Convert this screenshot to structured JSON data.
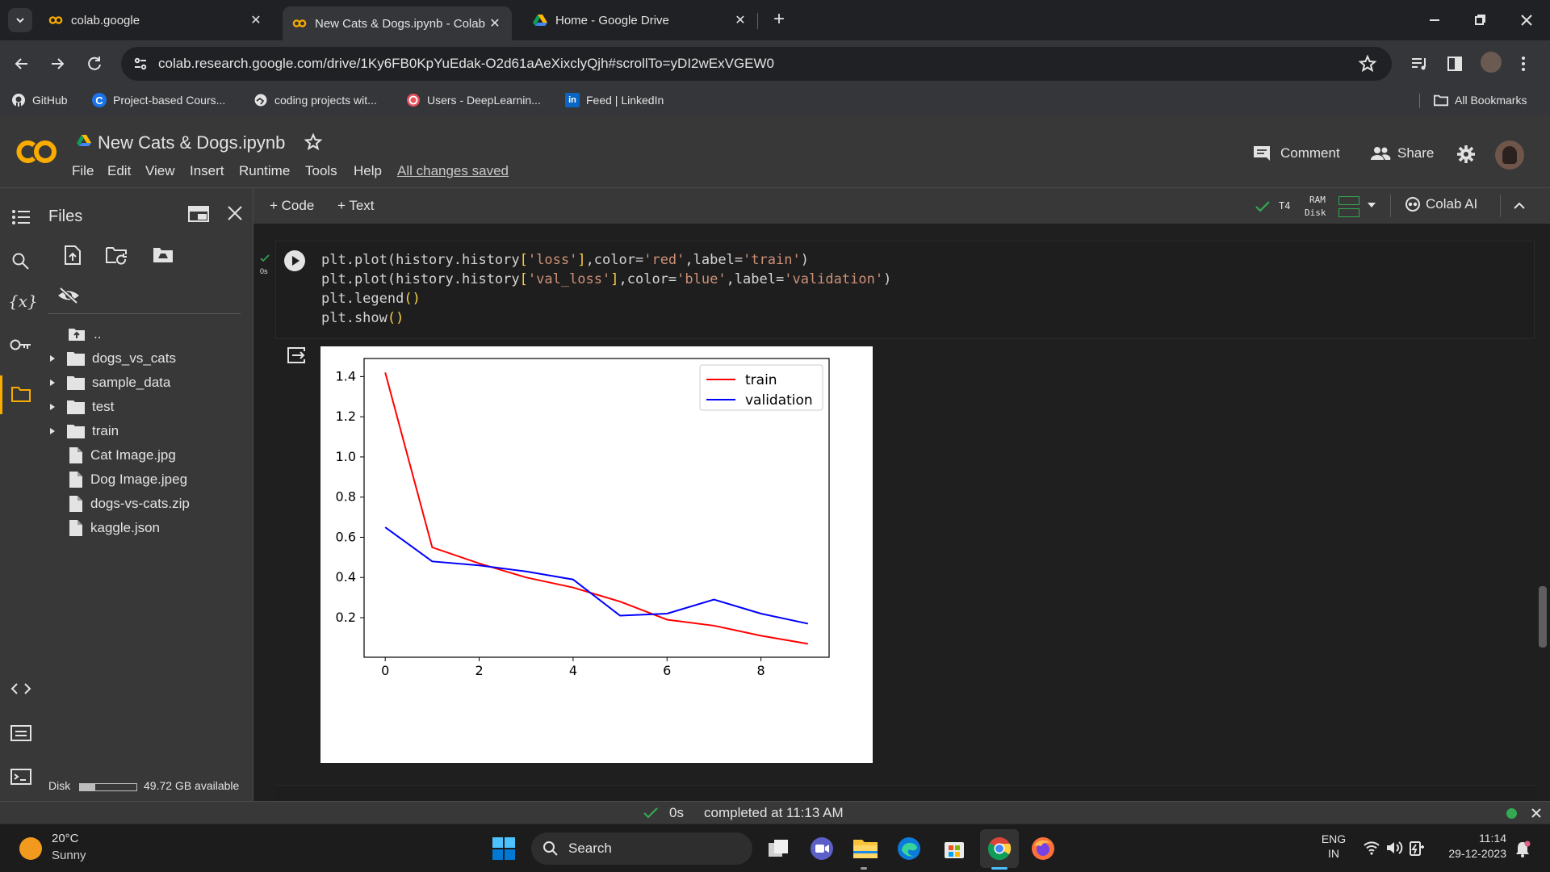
{
  "browser": {
    "tabs": [
      {
        "title": "colab.google",
        "icon": "colab-icon"
      },
      {
        "title": "New Cats & Dogs.ipynb - Colab",
        "icon": "colab-icon",
        "active": true
      },
      {
        "title": "Home - Google Drive",
        "icon": "google-drive-icon"
      }
    ],
    "url": "colab.research.google.com/drive/1Ky6FB0KpYuEdak-O2d61aAeXixclyQjh#scrollTo=yDI2wExVGEW0",
    "bookmarks": [
      "GitHub",
      "Project-based Cours...",
      "coding projects wit...",
      "Users - DeepLearnin...",
      "Feed | LinkedIn"
    ],
    "all_bookmarks": "All Bookmarks"
  },
  "colab": {
    "notebook_title": "New Cats & Dogs.ipynb",
    "menu": [
      "File",
      "Edit",
      "View",
      "Insert",
      "Runtime",
      "Tools",
      "Help"
    ],
    "save_status": "All changes saved",
    "comment_label": "Comment",
    "share_label": "Share",
    "add_code": "+ Code",
    "add_text": "+ Text",
    "runtime": {
      "gpu": "T4",
      "ram_label": "RAM",
      "disk_label": "Disk"
    },
    "colab_ai": "Colab AI",
    "cell_exec_time": "0s"
  },
  "sidebar": {
    "title": "Files",
    "parent": "..",
    "items": [
      {
        "name": "dogs_vs_cats",
        "type": "folder"
      },
      {
        "name": "sample_data",
        "type": "folder"
      },
      {
        "name": "test",
        "type": "folder"
      },
      {
        "name": "train",
        "type": "folder"
      },
      {
        "name": "Cat Image.jpg",
        "type": "file"
      },
      {
        "name": "Dog Image.jpeg",
        "type": "file"
      },
      {
        "name": "dogs-vs-cats.zip",
        "type": "file"
      },
      {
        "name": "kaggle.json",
        "type": "file"
      }
    ],
    "disk_label": "Disk",
    "disk_available": "49.72 GB available",
    "disk_used_fraction": 0.27
  },
  "code": {
    "lines": [
      "plt.plot(history.history['loss'],color='red',label='train')",
      "plt.plot(history.history['val_loss'],color='blue',label='validation')",
      "plt.legend()",
      "plt.show()"
    ]
  },
  "chart_data": {
    "type": "line",
    "x": [
      0,
      1,
      2,
      3,
      4,
      5,
      6,
      7,
      8,
      9
    ],
    "series": [
      {
        "name": "train",
        "color": "#ff0000",
        "values": [
          1.42,
          0.55,
          0.47,
          0.4,
          0.35,
          0.28,
          0.19,
          0.16,
          0.11,
          0.07
        ]
      },
      {
        "name": "validation",
        "color": "#0000ff",
        "values": [
          0.65,
          0.48,
          0.46,
          0.43,
          0.39,
          0.21,
          0.22,
          0.29,
          0.22,
          0.17
        ]
      }
    ],
    "xticks": [
      0,
      2,
      4,
      6,
      8
    ],
    "yticks": [
      0.2,
      0.4,
      0.6,
      0.8,
      1.0,
      1.2,
      1.4
    ],
    "xlim": [
      -0.45,
      9.45
    ],
    "ylim": [
      0.003,
      1.49
    ],
    "legend": "top-right"
  },
  "status": {
    "exec_time": "0s",
    "completed": "completed at 11:13 AM"
  },
  "taskbar": {
    "weather_temp": "20°C",
    "weather_desc": "Sunny",
    "search": "Search",
    "lang": "ENG",
    "region": "IN",
    "time": "11:14",
    "date": "29-12-2023"
  }
}
